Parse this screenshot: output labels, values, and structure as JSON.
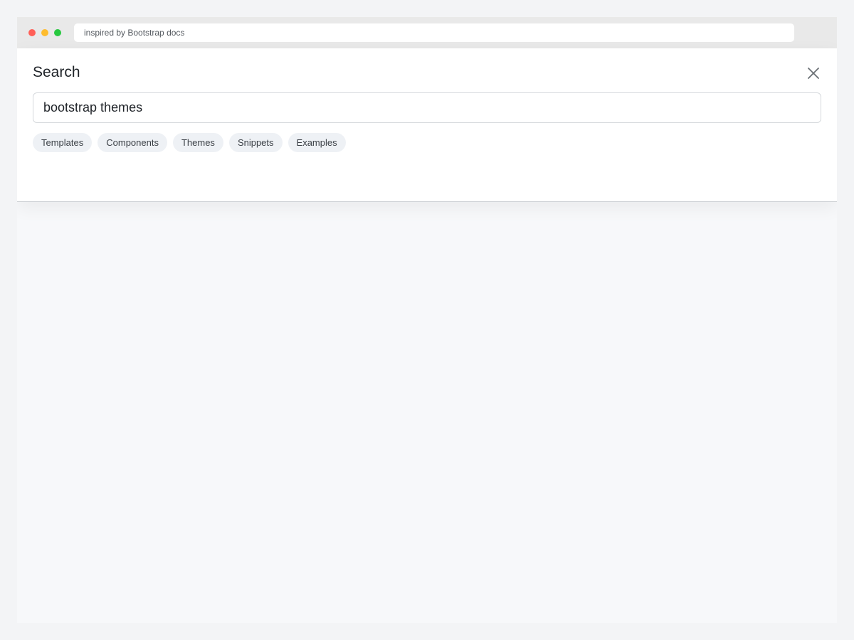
{
  "window": {
    "address_text": "inspired by Bootstrap docs"
  },
  "search_panel": {
    "title": "Search",
    "query_value": "bootstrap themes",
    "close_icon": "close-icon",
    "chips": [
      {
        "label": "Templates"
      },
      {
        "label": "Components"
      },
      {
        "label": "Themes"
      },
      {
        "label": "Snippets"
      },
      {
        "label": "Examples"
      }
    ]
  },
  "colors": {
    "close_red": "#ff5f57",
    "minimize_yellow": "#febc2e",
    "maximize_green": "#28c840",
    "chip_bg": "#eef1f5",
    "panel_bg": "#ffffff",
    "page_bg": "#f7f8fa"
  }
}
